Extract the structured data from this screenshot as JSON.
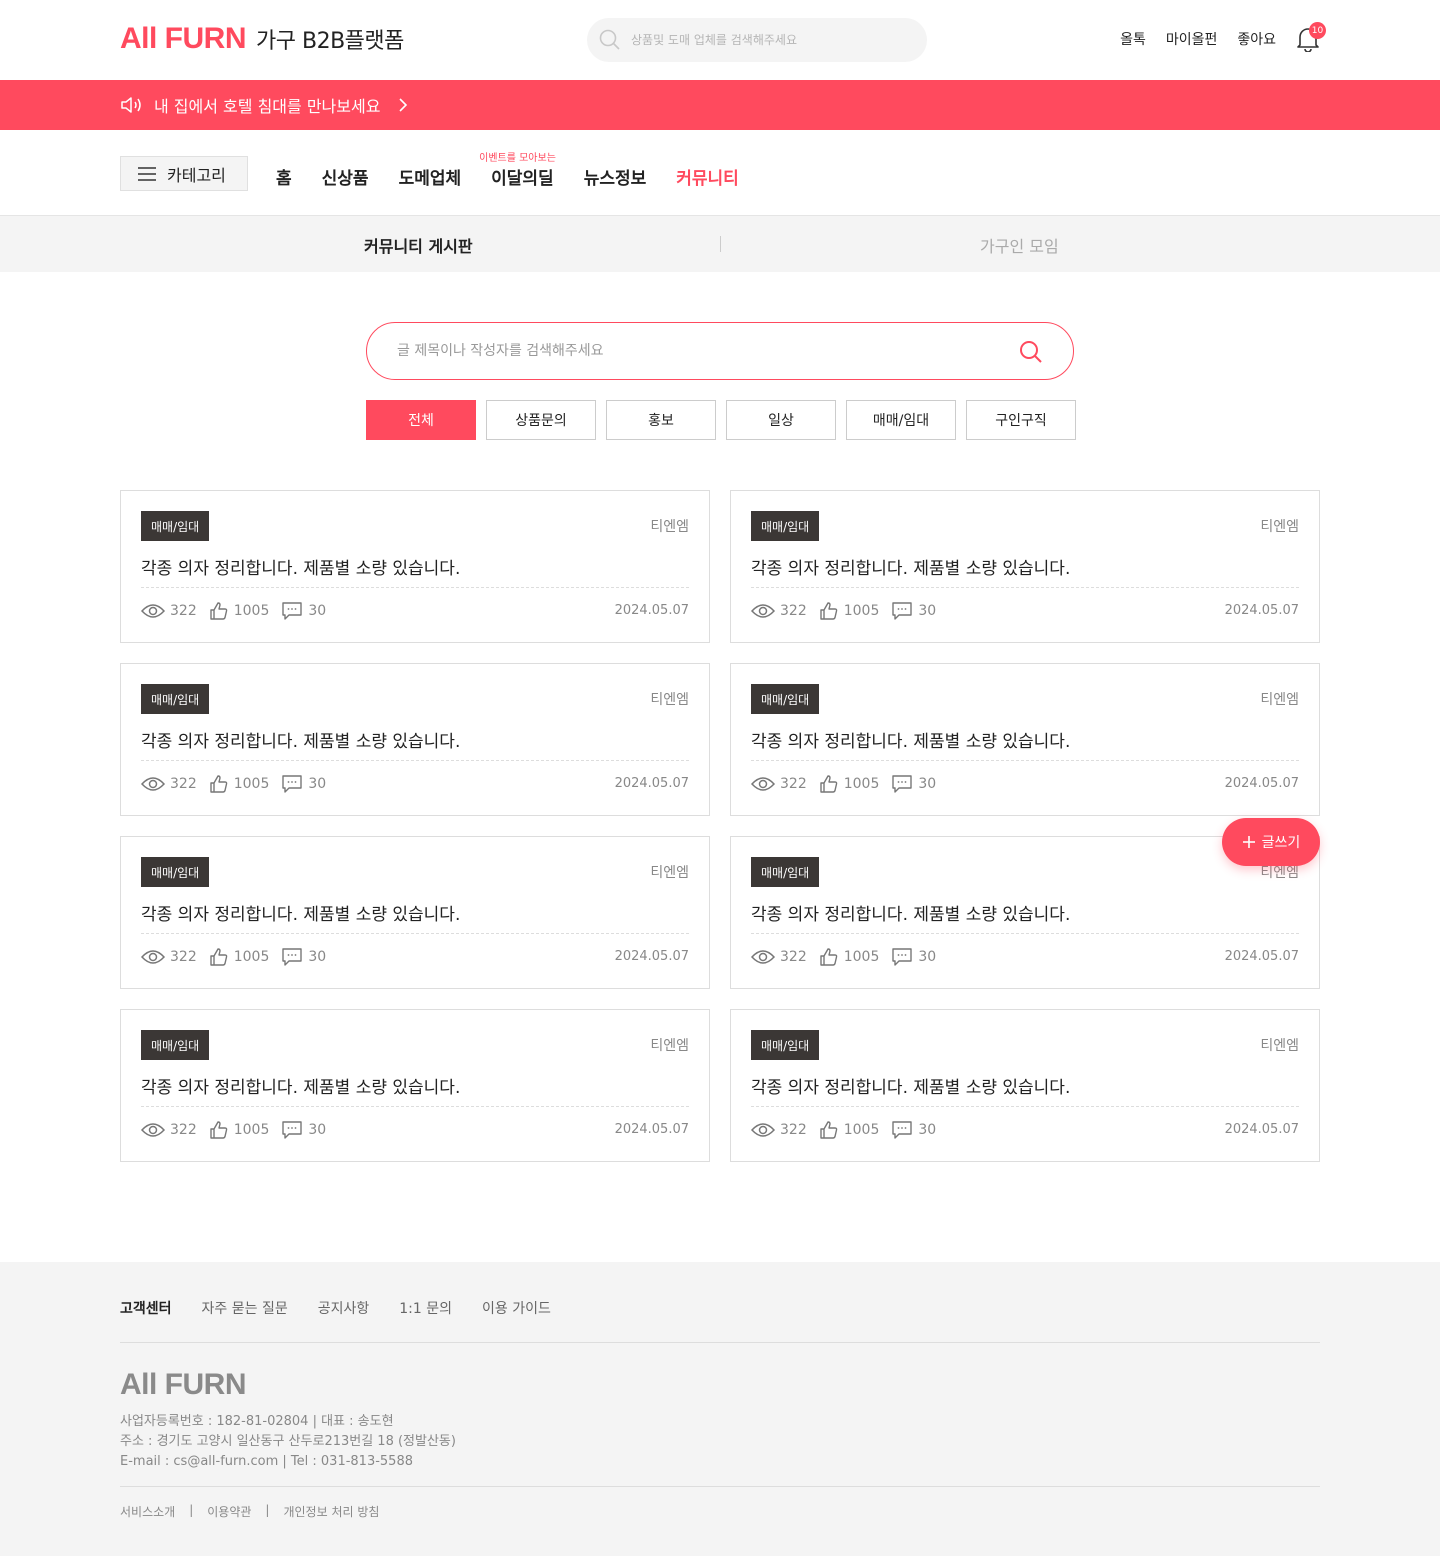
{
  "header": {
    "brand": "All FURN",
    "tagline": "가구 B2B플랫폼",
    "search_placeholder": "상품및 도매 업체를 검색해주세요",
    "links": [
      "올톡",
      "마이올펀",
      "좋아요"
    ],
    "notification_count": "10"
  },
  "banner": {
    "text": "내 집에서 호텔 침대를 만나보세요"
  },
  "nav": {
    "category_label": "카테고리",
    "items": [
      "홈",
      "신상품",
      "도메업체",
      "이달의딜",
      "뉴스정보",
      "커뮤니티"
    ],
    "deal_tip": "이벤트를 모아보는",
    "active": "커뮤니티"
  },
  "subtabs": {
    "left": "커뮤니티 게시판",
    "right": "가구인 모임"
  },
  "board": {
    "search_placeholder": "글 제목이나 작성자를 검색해주세요",
    "filters": [
      "전체",
      "상품문의",
      "홍보",
      "일상",
      "매매/임대",
      "구인구직"
    ],
    "posts": [
      {
        "tag": "매매/임대",
        "author": "티엔엠",
        "title": "각종 의자 정리합니다. 제품별 소량 있습니다.",
        "views": "322",
        "likes": "1005",
        "comments": "30",
        "date": "2024.05.07"
      },
      {
        "tag": "매매/임대",
        "author": "티엔엠",
        "title": "각종 의자 정리합니다. 제품별 소량 있습니다.",
        "views": "322",
        "likes": "1005",
        "comments": "30",
        "date": "2024.05.07"
      },
      {
        "tag": "매매/임대",
        "author": "티엔엠",
        "title": "각종 의자 정리합니다. 제품별 소량 있습니다.",
        "views": "322",
        "likes": "1005",
        "comments": "30",
        "date": "2024.05.07"
      },
      {
        "tag": "매매/임대",
        "author": "티엔엠",
        "title": "각종 의자 정리합니다. 제품별 소량 있습니다.",
        "views": "322",
        "likes": "1005",
        "comments": "30",
        "date": "2024.05.07"
      },
      {
        "tag": "매매/임대",
        "author": "티엔엠",
        "title": "각종 의자 정리합니다. 제품별 소량 있습니다.",
        "views": "322",
        "likes": "1005",
        "comments": "30",
        "date": "2024.05.07"
      },
      {
        "tag": "매매/임대",
        "author": "티엔엠",
        "title": "각종 의자 정리합니다. 제품별 소량 있습니다.",
        "views": "322",
        "likes": "1005",
        "comments": "30",
        "date": "2024.05.07"
      },
      {
        "tag": "매매/임대",
        "author": "티엔엠",
        "title": "각종 의자 정리합니다. 제품별 소량 있습니다.",
        "views": "322",
        "likes": "1005",
        "comments": "30",
        "date": "2024.05.07"
      },
      {
        "tag": "매매/임대",
        "author": "티엔엠",
        "title": "각종 의자 정리합니다. 제품별 소량 있습니다.",
        "views": "322",
        "likes": "1005",
        "comments": "30",
        "date": "2024.05.07"
      }
    ],
    "write_label": "글쓰기"
  },
  "footer": {
    "nav": [
      "고객센터",
      "자주 묻는 질문",
      "공지사항",
      "1:1 문의",
      "이용 가이드"
    ],
    "brand": "All FURN",
    "info": [
      "사업자등록번호 : 182-81-02804 | 대표 : 송도현",
      "주소 : 경기도 고양시 일산동구 산두로213번길 18 (정발산동)",
      "E-mail : cs@all-furn.com | Tel : 031-813-5588"
    ],
    "links": [
      "서비스소개",
      "|",
      "이용약관",
      "|",
      "개인정보 처리 방침"
    ]
  },
  "colors": {
    "accent": "#ff4a5e",
    "tag_bg": "#3b3735",
    "footer_bg": "#f4f4f4"
  },
  "icons": [
    "search-icon",
    "bell-icon",
    "speaker-icon",
    "chevron-right-icon",
    "menu-icon",
    "eye-icon",
    "thumbs-up-icon",
    "comment-icon",
    "plus-icon"
  ]
}
